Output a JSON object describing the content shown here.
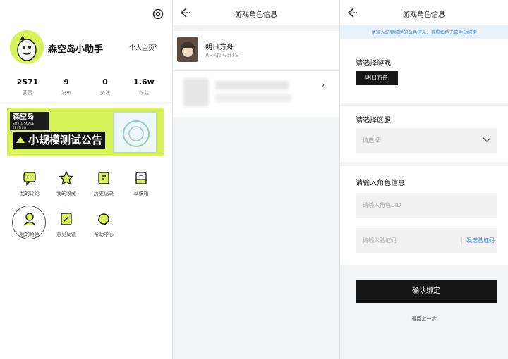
{
  "profile": {
    "name": "森空岛小助手",
    "homepage_label": "个人主页",
    "stats": [
      {
        "value": "2571",
        "label": "获赞"
      },
      {
        "value": "9",
        "label": "发布"
      },
      {
        "value": "0",
        "label": "关注"
      },
      {
        "value": "1.6w",
        "label": "粉丝"
      }
    ]
  },
  "banner": {
    "logo_text": "森空岛",
    "logo_sub": "SMALL SCALE TESTING",
    "title": "小规模测试公告"
  },
  "menu": [
    {
      "label": "我的评论",
      "icon": "comment-icon"
    },
    {
      "label": "我的收藏",
      "icon": "star-icon"
    },
    {
      "label": "历史记录",
      "icon": "history-icon"
    },
    {
      "label": "草稿箱",
      "icon": "draft-icon"
    },
    {
      "label": "我的角色",
      "icon": "character-icon"
    },
    {
      "label": "意见反馈",
      "icon": "feedback-icon"
    },
    {
      "label": "帮助中心",
      "icon": "help-icon"
    }
  ],
  "game_list": {
    "title": "游戏角色信息",
    "game_name": "明日方舟",
    "game_en": "ARKNIGHTS"
  },
  "bind_form": {
    "title": "游戏角色信息",
    "notice": "请输入您要绑定的角色信息，首服角色无需手动绑定",
    "select_game_label": "请选择游戏",
    "selected_game": "明日方舟",
    "select_server_label": "请选择区服",
    "server_placeholder": "请选择",
    "role_info_label": "请输入角色信息",
    "uid_placeholder": "请输入角色UID",
    "code_placeholder": "请输入验证码",
    "send_code": "发送验证码",
    "confirm": "确认绑定",
    "back_step": "返回上一步"
  },
  "colors": {
    "accent_green": "#d8f35a",
    "link_blue": "#3f86d8",
    "dark": "#151515"
  }
}
